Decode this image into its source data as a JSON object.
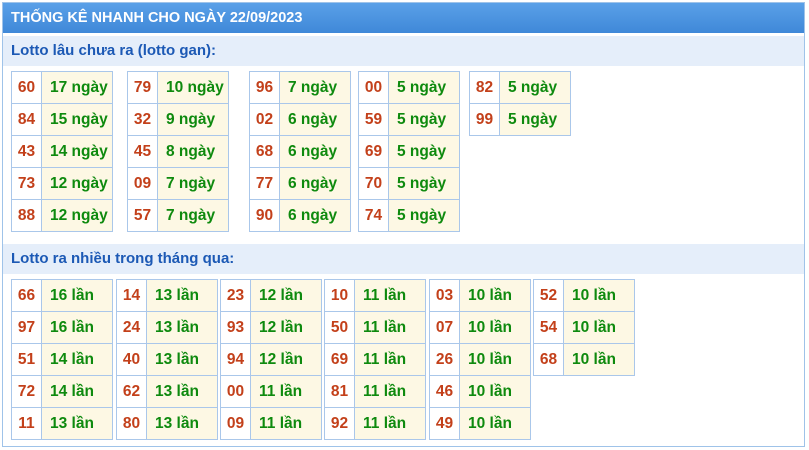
{
  "title": "THỐNG KÊ NHANH CHO NGÀY 22/09/2023",
  "gan": {
    "header": "Lotto lâu chưa ra (lotto gan):",
    "groups": [
      [
        {
          "n": "60",
          "v": "17 ngày"
        },
        {
          "n": "84",
          "v": "15 ngày"
        },
        {
          "n": "43",
          "v": "14 ngày"
        },
        {
          "n": "73",
          "v": "12 ngày"
        },
        {
          "n": "88",
          "v": "12 ngày"
        }
      ],
      [
        {
          "n": "79",
          "v": "10 ngày"
        },
        {
          "n": "32",
          "v": "9 ngày"
        },
        {
          "n": "45",
          "v": "8 ngày"
        },
        {
          "n": "09",
          "v": "7 ngày"
        },
        {
          "n": "57",
          "v": "7 ngày"
        }
      ],
      [
        {
          "n": "96",
          "v": "7 ngày"
        },
        {
          "n": "02",
          "v": "6 ngày"
        },
        {
          "n": "68",
          "v": "6 ngày"
        },
        {
          "n": "77",
          "v": "6 ngày"
        },
        {
          "n": "90",
          "v": "6 ngày"
        }
      ],
      [
        {
          "n": "00",
          "v": "5 ngày"
        },
        {
          "n": "59",
          "v": "5 ngày"
        },
        {
          "n": "69",
          "v": "5 ngày"
        },
        {
          "n": "70",
          "v": "5 ngày"
        },
        {
          "n": "74",
          "v": "5 ngày"
        }
      ],
      [
        {
          "n": "82",
          "v": "5 ngày"
        },
        {
          "n": "99",
          "v": "5 ngày"
        }
      ]
    ]
  },
  "nhieu": {
    "header": "Lotto ra nhiều trong tháng qua:",
    "groups": [
      [
        {
          "n": "66",
          "v": "16 lần"
        },
        {
          "n": "97",
          "v": "16 lần"
        },
        {
          "n": "51",
          "v": "14 lần"
        },
        {
          "n": "72",
          "v": "14 lần"
        },
        {
          "n": "11",
          "v": "13 lần"
        }
      ],
      [
        {
          "n": "14",
          "v": "13 lần"
        },
        {
          "n": "24",
          "v": "13 lần"
        },
        {
          "n": "40",
          "v": "13 lần"
        },
        {
          "n": "62",
          "v": "13 lần"
        },
        {
          "n": "80",
          "v": "13 lần"
        }
      ],
      [
        {
          "n": "23",
          "v": "12 lần"
        },
        {
          "n": "93",
          "v": "12 lần"
        },
        {
          "n": "94",
          "v": "12 lần"
        },
        {
          "n": "00",
          "v": "11 lần"
        },
        {
          "n": "09",
          "v": "11 lần"
        }
      ],
      [
        {
          "n": "10",
          "v": "11 lần"
        },
        {
          "n": "50",
          "v": "11 lần"
        },
        {
          "n": "69",
          "v": "11 lần"
        },
        {
          "n": "81",
          "v": "11 lần"
        },
        {
          "n": "92",
          "v": "11 lần"
        }
      ],
      [
        {
          "n": "03",
          "v": "10 lần"
        },
        {
          "n": "07",
          "v": "10 lần"
        },
        {
          "n": "26",
          "v": "10 lần"
        },
        {
          "n": "46",
          "v": "10 lần"
        },
        {
          "n": "49",
          "v": "10 lần"
        }
      ],
      [
        {
          "n": "52",
          "v": "10 lần"
        },
        {
          "n": "54",
          "v": "10 lần"
        },
        {
          "n": "68",
          "v": "10 lần"
        }
      ]
    ]
  }
}
